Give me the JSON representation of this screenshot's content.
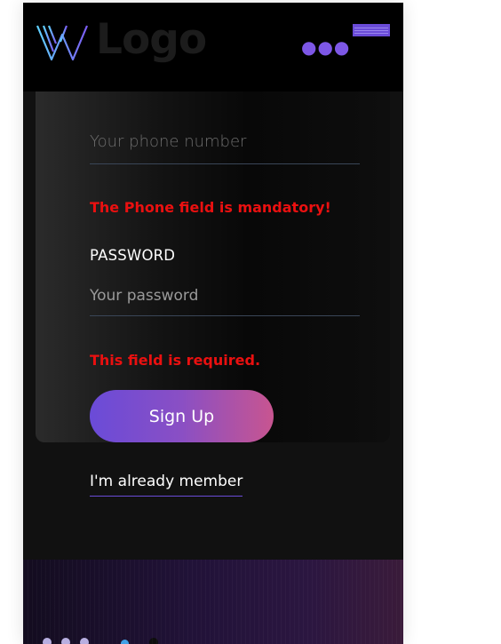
{
  "header": {
    "logo_text": "Logo",
    "more_icon": "ellipsis-icon",
    "menu_icon": "hamburger-menu-icon"
  },
  "form": {
    "phone_placeholder": "Your phone number",
    "phone_error": "The Phone field is mandatory!",
    "password_label": "PASSWORD",
    "password_placeholder": "Your password",
    "password_error": "This field is required.",
    "signup_label": "Sign Up",
    "member_link": "I'm already member"
  },
  "colors": {
    "accent": "#6a4bd8",
    "error": "#ea1010",
    "button_gradient_end": "#c85590",
    "page_background": "#111111"
  }
}
